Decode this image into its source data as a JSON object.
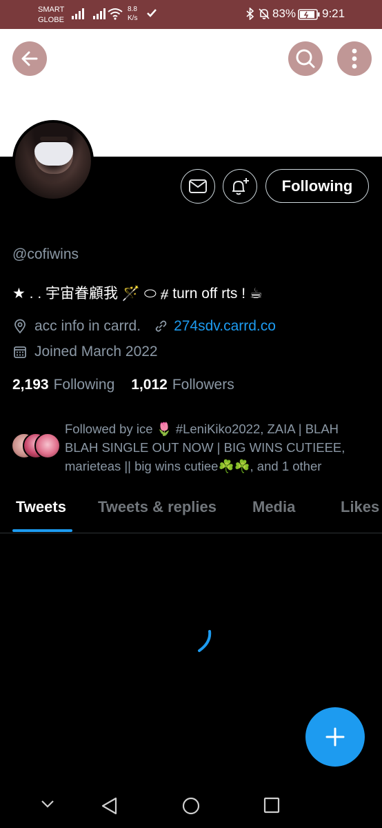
{
  "status_bar": {
    "carrier_line1": "SMART",
    "carrier_line2": "GLOBE",
    "speed_value": "8.8",
    "speed_unit": "K/s",
    "battery_percent": "83%",
    "time": "9:21"
  },
  "header": {
    "back_icon": "arrow-left-icon",
    "search_icon": "search-icon",
    "more_icon": "more-vertical-icon",
    "banner_color": "#ffffff",
    "button_color": "#c09796"
  },
  "profile": {
    "handle": "@cofiwins",
    "bio": "★ . . 宇宙眷顧我 🪄 ⬭ ⧣ turn off rts ! ☕",
    "location": "acc info in carrd.",
    "link": "274sdv.carrd.co",
    "joined": "Joined March 2022",
    "following_count": "2,193",
    "following_label": "Following",
    "followers_count": "1,012",
    "followers_label": "Followers"
  },
  "actions": {
    "message_icon": "mail-icon",
    "notify_icon": "bell-plus-icon",
    "follow_state_label": "Following"
  },
  "followed_by": {
    "text": "Followed by ice 🌷 #LeniKiko2022, ZAIA | BLAH BLAH SINGLE OUT NOW | BIG WINS CUTIEEE, marieteas || big wins cutiee☘️☘️, and 1 other"
  },
  "tabs": [
    {
      "label": "Tweets",
      "active": true
    },
    {
      "label": "Tweets & replies",
      "active": false
    },
    {
      "label": "Media",
      "active": false
    },
    {
      "label": "Likes",
      "active": false
    }
  ],
  "fab": {
    "icon": "plus-icon",
    "color": "#1d9bf0"
  },
  "colors": {
    "accent": "#1d9bf0",
    "status_bar": "#7a3a3c",
    "muted_text": "#8b98a5"
  }
}
